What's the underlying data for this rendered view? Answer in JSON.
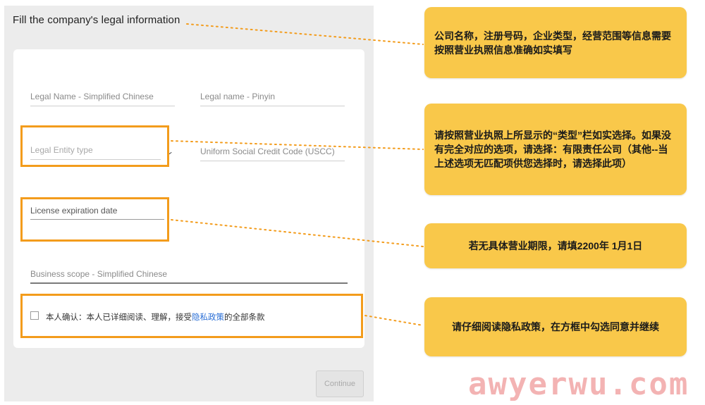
{
  "form": {
    "title": "Fill the company's legal information",
    "fields": {
      "legal_name_cn": "Legal Name - Simplified Chinese",
      "legal_name_pinyin": "Legal name - Pinyin",
      "entity_type": "Legal Entity type",
      "uscc": "Uniform Social Credit Code (USCC)",
      "license_expiration": "License expiration date",
      "business_scope": "Business scope - Simplified Chinese"
    },
    "consent": {
      "prefix": "本人确认：本人已详细阅读、理解，接受",
      "link": "隐私政策",
      "suffix": "的全部条款"
    },
    "continue_label": "Continue"
  },
  "notes": {
    "n1": "公司名称，注册号码，企业类型，经营范围等信息需要按照营业执照信息准确如实填写",
    "n2": "请按照营业执照上所显示的“类型”栏如实选择。如果没有完全对应的选项，请选择：有限责任公司（其他--当上述选项无匹配项供您选择时，请选择此项）",
    "n3": "若无具体营业期限，请填2200年 1月1日",
    "n4": "请仔细阅读隐私政策，在方框中勾选同意并继续"
  },
  "watermark": "awyerwu.com",
  "colors": {
    "highlight": "#f39c1c",
    "note_bg": "#f9c84a",
    "link": "#2b6fd6"
  },
  "icons": {
    "dropdown": "chevron-down-icon",
    "checkbox": "checkbox-icon"
  }
}
